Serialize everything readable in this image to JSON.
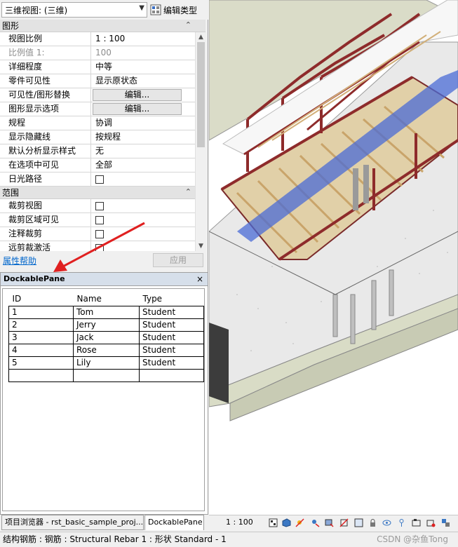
{
  "typeSelector": {
    "value": "三维视图: (三维)",
    "editTypeLabel": "编辑类型"
  },
  "groups": [
    {
      "title": "图形"
    },
    {
      "title": "范围"
    }
  ],
  "graphicsProps": [
    {
      "key": "视图比例",
      "value": "1 : 100"
    },
    {
      "key": "比例值 1:",
      "value": "100"
    },
    {
      "key": "详细程度",
      "value": "中等"
    },
    {
      "key": "零件可见性",
      "value": "显示原状态"
    },
    {
      "key": "可见性/图形替换",
      "value": "编辑..."
    },
    {
      "key": "图形显示选项",
      "value": "编辑..."
    },
    {
      "key": "规程",
      "value": "协调"
    },
    {
      "key": "显示隐藏线",
      "value": "按规程"
    },
    {
      "key": "默认分析显示样式",
      "value": "无"
    },
    {
      "key": "在选项中可见",
      "value": "全部"
    },
    {
      "key": "日光路径",
      "value": ""
    }
  ],
  "extentProps": [
    {
      "key": "裁剪视图"
    },
    {
      "key": "裁剪区域可见"
    },
    {
      "key": "注释裁剪"
    },
    {
      "key": "远剪裁激活"
    }
  ],
  "help": {
    "link": "属性帮助",
    "apply": "应用"
  },
  "pane": {
    "title": "DockablePane",
    "close": "×",
    "columns": [
      "ID",
      "Name",
      "Type"
    ],
    "rows": [
      [
        "1",
        "Tom",
        "Student"
      ],
      [
        "2",
        "Jerry",
        "Student"
      ],
      [
        "3",
        "Jack",
        "Student"
      ],
      [
        "4",
        "Rose",
        "Student"
      ],
      [
        "5",
        "Lily",
        "Student"
      ],
      [
        "",
        "",
        ""
      ]
    ]
  },
  "tabs": [
    "项目浏览器 - rst_basic_sample_proj...",
    "DockablePane"
  ],
  "viewControl": {
    "scale": "1 : 100"
  },
  "status": {
    "text": "结构钢筋 : 钢筋 : Structural Rebar 1 : 形状 Standard - 1",
    "watermark": "CSDN @杂鱼Tong"
  },
  "colors": {
    "steel": "#8e2b2b",
    "joist": "#d2b07a",
    "glass": "#4a6bd6",
    "arrow": "#e02020"
  }
}
